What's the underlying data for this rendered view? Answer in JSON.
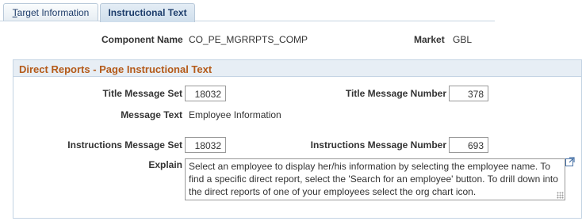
{
  "tabs": [
    {
      "label_prefix": "T",
      "label_rest": "arget Information",
      "active": false
    },
    {
      "label": "Instructional Text",
      "active": true
    }
  ],
  "header": {
    "component_name_label": "Component Name",
    "component_name_value": "CO_PE_MGRRPTS_COMP",
    "market_label": "Market",
    "market_value": "GBL"
  },
  "group": {
    "title": "Direct Reports - Page Instructional Text",
    "title_message_set_label": "Title Message Set",
    "title_message_set_value": "18032",
    "title_message_number_label": "Title Message Number",
    "title_message_number_value": "378",
    "message_text_label": "Message Text",
    "message_text_value": "Employee Information",
    "instructions_message_set_label": "Instructions Message Set",
    "instructions_message_set_value": "18032",
    "instructions_message_number_label": "Instructions Message Number",
    "instructions_message_number_value": "693",
    "explain_label": "Explain",
    "explain_value": "Select an employee to display her/his information by selecting the employee name. To find a specific direct report, select the 'Search for an employee' button. To drill down into the direct reports of one of your employees select the org chart icon."
  },
  "icons": {
    "expand": "expand-icon",
    "resize": "resize-grip-icon"
  },
  "colors": {
    "group_title": "#b45a19",
    "tab_text": "#1c3c6b",
    "border": "#c3d3e3"
  }
}
